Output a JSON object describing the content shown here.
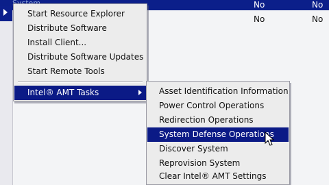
{
  "list": {
    "header_label": "System",
    "rows": [
      {
        "col1": "No",
        "col2": "No"
      },
      {
        "col1": "No",
        "col2": "No"
      }
    ]
  },
  "menu_main": {
    "items": [
      {
        "label": "Start Resource Explorer"
      },
      {
        "label": "Distribute Software"
      },
      {
        "label": "Install Client..."
      },
      {
        "label": "Distribute Software Updates"
      },
      {
        "label": "Start Remote Tools"
      },
      {
        "label": "Intel® AMT Tasks"
      }
    ]
  },
  "menu_amt": {
    "items": [
      {
        "label": "Asset Identification Information"
      },
      {
        "label": "Power Control Operations"
      },
      {
        "label": "Redirection Operations"
      },
      {
        "label": "System Defense Operations"
      },
      {
        "label": "Discover System"
      },
      {
        "label": "Reprovision System"
      },
      {
        "label": "Clear Intel® AMT Settings"
      }
    ]
  },
  "colors": {
    "highlight": "#0b1a86",
    "menu_bg": "#ececec",
    "list_bg": "#f3f4f6"
  },
  "icons": {
    "submenu": "submenu-arrow-icon",
    "pointer": "mouse-pointer-icon"
  }
}
